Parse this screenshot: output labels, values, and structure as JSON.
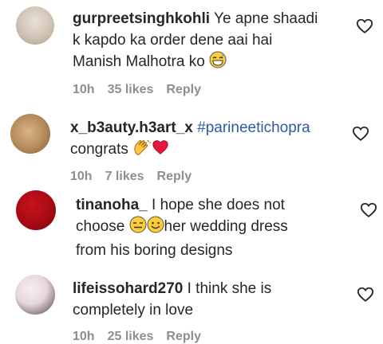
{
  "comments": [
    {
      "username": "gurpreetsinghkohli",
      "text_line1": " Ye apne shaadi",
      "text_line2": "k kapdo ka order dene aai hai",
      "text_line3": "Manish Malhotra ko ",
      "time": "10h",
      "likes": "35 likes",
      "reply": "Reply",
      "emoji": "grinning-sweat-emoji"
    },
    {
      "username": "x_b3auty.h3art_x",
      "hashtag": " #parineetichopra",
      "text_line2": "congrats ",
      "time": "10h",
      "likes": "7 likes",
      "reply": "Reply",
      "emojis": [
        "clapping-hands-emoji",
        "red-heart-emoji"
      ]
    },
    {
      "username": "tinanoha_",
      "text_line1": "  I hope she does not",
      "text_line2a": "choose ",
      "text_line2b": "her wedding dress",
      "text_line3": "from his boring designs",
      "emojis": [
        "expressionless-face-emoji",
        "slightly-smiling-face-emoji"
      ]
    },
    {
      "username": "lifeissohard270",
      "text_line1": " I think she is",
      "text_line2": "completely in love",
      "time": "10h",
      "likes": "25 likes",
      "reply": "Reply"
    }
  ],
  "icons": {
    "like": "heart-outline-icon"
  },
  "colors": {
    "text": "#262626",
    "meta": "#8e8e8e",
    "hashtag": "#2e5aa5"
  }
}
